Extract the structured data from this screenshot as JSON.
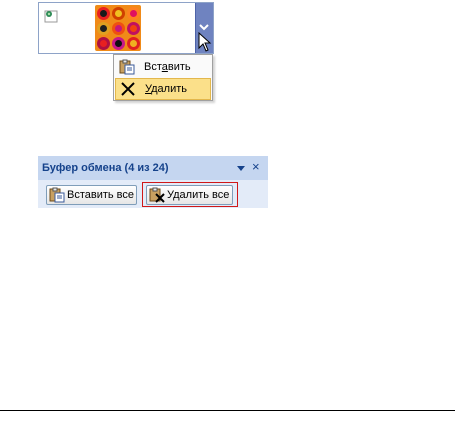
{
  "context_menu": {
    "paste": {
      "before": "Вст",
      "underline": "а",
      "after": "вить",
      "icon": "paste-icon"
    },
    "delete": {
      "before": "",
      "underline": "У",
      "after": "далить",
      "icon": "delete-x-icon"
    }
  },
  "clipboard_pane": {
    "title": "Буфер обмена (4 из 24)",
    "paste_all_label": "Вставить все",
    "clear_all_label": "Удалить все",
    "options_icon": "triangle-down-icon",
    "close_glyph": "×"
  },
  "colors": {
    "pane_title": "#15428b",
    "menu_highlight": "#fbe08a",
    "focus_frame": "#d01818",
    "thumb_background": "#f08a18"
  }
}
